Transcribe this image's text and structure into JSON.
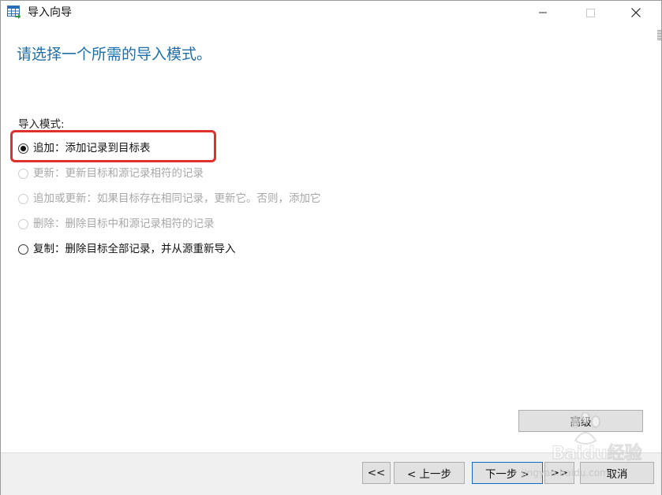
{
  "window": {
    "title": "导入向导",
    "app_icon": "table-import-icon"
  },
  "heading": "请选择一个所需的导入模式。",
  "mode_group": {
    "label": "导入模式:",
    "options": [
      {
        "label": "追加：添加记录到目标表",
        "selected": true,
        "enabled": true
      },
      {
        "label": "更新：更新目标和源记录相符的记录",
        "selected": false,
        "enabled": false
      },
      {
        "label": "追加或更新：如果目标存在相同记录，更新它。否则，添加它",
        "selected": false,
        "enabled": false
      },
      {
        "label": "删除：删除目标中和源记录相符的记录",
        "selected": false,
        "enabled": false
      },
      {
        "label": "复制：删除目标全部记录，并从源重新导入",
        "selected": false,
        "enabled": true
      }
    ]
  },
  "buttons": {
    "advanced": "高级",
    "first": "<<",
    "prev": "< 上一步",
    "next": "下一步 >",
    "last": ">>",
    "cancel": "取消"
  },
  "watermark": {
    "text": "Baidu经验",
    "url": "jingyan.baidu.com"
  },
  "colors": {
    "heading": "#1e6fa8",
    "highlight": "#e0302c",
    "default_button_border": "#0a6cc8",
    "disabled_text": "#a7a7a7"
  }
}
